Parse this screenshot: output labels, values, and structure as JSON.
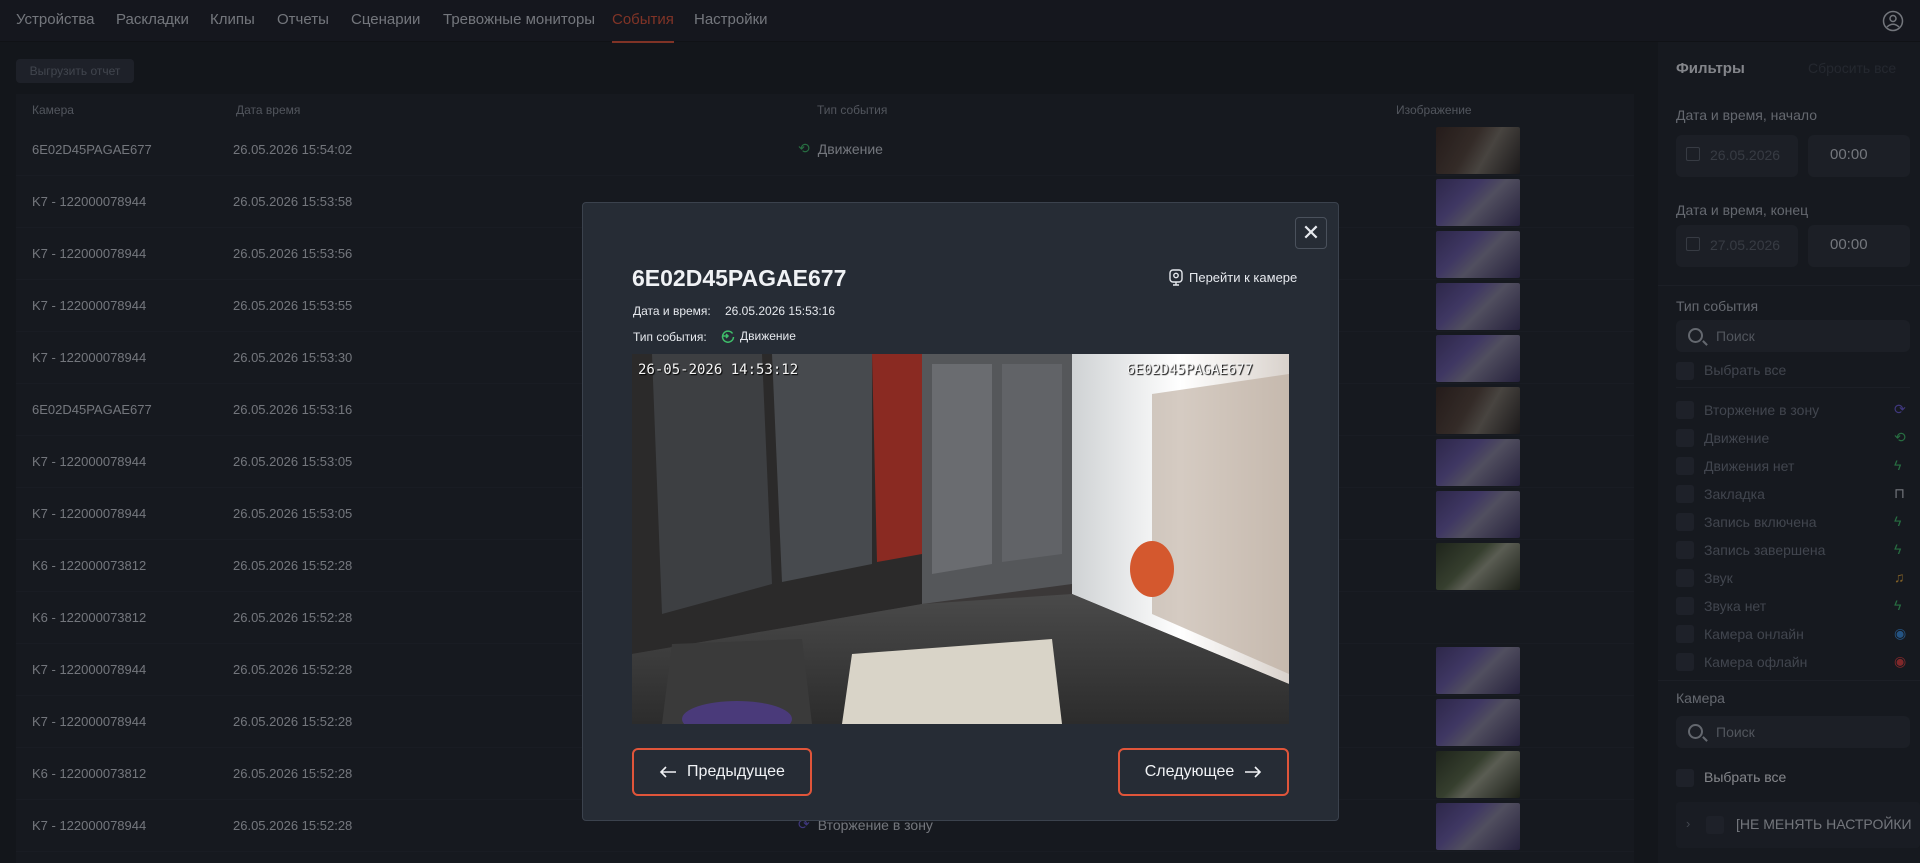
{
  "nav": {
    "tabs": [
      "Устройства",
      "Раскладки",
      "Клипы",
      "Отчеты",
      "Сценарии",
      "Тревожные мониторы",
      "События",
      "Настройки"
    ],
    "active": "События"
  },
  "toolbar": {
    "export_label": "Выгрузить отчет"
  },
  "table": {
    "headers": {
      "camera": "Камера",
      "datetime": "Дата время",
      "event_type": "Тип события",
      "image": "Изображение"
    },
    "rows": [
      {
        "camera": "6E02D45PAGAE677",
        "datetime": "26.05.2026 15:54:02",
        "event": "Движение",
        "event_icon": "motion-icon",
        "thumb": "dark"
      },
      {
        "camera": "K7 - 122000078944",
        "datetime": "26.05.2026 15:53:58",
        "event": "",
        "event_icon": "",
        "thumb": "purple"
      },
      {
        "camera": "K7 - 122000078944",
        "datetime": "26.05.2026 15:53:56",
        "event": "",
        "event_icon": "",
        "thumb": "purple"
      },
      {
        "camera": "K7 - 122000078944",
        "datetime": "26.05.2026 15:53:55",
        "event": "",
        "event_icon": "",
        "thumb": "purple"
      },
      {
        "camera": "K7 - 122000078944",
        "datetime": "26.05.2026 15:53:30",
        "event": "",
        "event_icon": "",
        "thumb": "purple"
      },
      {
        "camera": "6E02D45PAGAE677",
        "datetime": "26.05.2026 15:53:16",
        "event": "",
        "event_icon": "",
        "thumb": "dark"
      },
      {
        "camera": "K7 - 122000078944",
        "datetime": "26.05.2026 15:53:05",
        "event": "",
        "event_icon": "",
        "thumb": "purple"
      },
      {
        "camera": "K7 - 122000078944",
        "datetime": "26.05.2026 15:53:05",
        "event": "",
        "event_icon": "",
        "thumb": "purple"
      },
      {
        "camera": "K6 - 122000073812",
        "datetime": "26.05.2026 15:52:28",
        "event": "",
        "event_icon": "",
        "thumb": "green"
      },
      {
        "camera": "K6 - 122000073812",
        "datetime": "26.05.2026 15:52:28",
        "event": "",
        "event_icon": "",
        "thumb": ""
      },
      {
        "camera": "K7 - 122000078944",
        "datetime": "26.05.2026 15:52:28",
        "event": "",
        "event_icon": "",
        "thumb": "purple"
      },
      {
        "camera": "K7 - 122000078944",
        "datetime": "26.05.2026 15:52:28",
        "event": "",
        "event_icon": "",
        "thumb": "purple"
      },
      {
        "camera": "K6 - 122000073812",
        "datetime": "26.05.2026 15:52:28",
        "event": "",
        "event_icon": "",
        "thumb": "green"
      },
      {
        "camera": "K7 - 122000078944",
        "datetime": "26.05.2026 15:52:28",
        "event": "Вторжение в зону",
        "event_icon": "intrusion-icon",
        "thumb": "purple"
      }
    ]
  },
  "filters": {
    "title": "Фильтры",
    "reset_label": "Сбросить все",
    "start": {
      "label": "Дата и время, начало",
      "date": "26.05.2026",
      "time": "00:00"
    },
    "end": {
      "label": "Дата и время, конец",
      "date": "27.05.2026",
      "time": "00:00"
    },
    "event_type": {
      "label": "Тип события",
      "search_placeholder": "Поиск",
      "select_all": "Выбрать все",
      "items": [
        {
          "label": "Вторжение в зону",
          "icon": "intrusion-icon",
          "color": "#6a5cd8",
          "glyph": "⟳"
        },
        {
          "label": "Движение",
          "icon": "motion-icon",
          "color": "#3fbf6a",
          "glyph": "⟲"
        },
        {
          "label": "Движения нет",
          "icon": "lightning-icon",
          "color": "#3fbf6a",
          "glyph": "ϟ"
        },
        {
          "label": "Закладка",
          "icon": "bookmark-icon",
          "color": "#c9ced6",
          "glyph": "⊓"
        },
        {
          "label": "Запись включена",
          "icon": "lightning-icon",
          "color": "#3fbf6a",
          "glyph": "ϟ"
        },
        {
          "label": "Запись завершена",
          "icon": "lightning-icon",
          "color": "#3fbf6a",
          "glyph": "ϟ"
        },
        {
          "label": "Звук",
          "icon": "music-note-icon",
          "color": "#e0a53a",
          "glyph": "♫"
        },
        {
          "label": "Звука нет",
          "icon": "lightning-icon",
          "color": "#3fbf6a",
          "glyph": "ϟ"
        },
        {
          "label": "Камера онлайн",
          "icon": "camera-online-icon",
          "color": "#3a8fe0",
          "glyph": "◉"
        },
        {
          "label": "Камера офлайн",
          "icon": "camera-offline-icon",
          "color": "#e04040",
          "glyph": "◉"
        }
      ]
    },
    "camera": {
      "label": "Камера",
      "search_placeholder": "Поиск",
      "select_all": "Выбрать все",
      "group": "[НЕ МЕНЯТЬ НАСТРОЙКИ"
    }
  },
  "modal": {
    "title": "6E02D45PAGAE677",
    "goto_label": "Перейти к камере",
    "datetime_label": "Дата и время:",
    "datetime_value": "26.05.2026 15:53:16",
    "event_label": "Тип события:",
    "event_value": "Движение",
    "osd_timestamp": "26-05-2026 14:53:12",
    "osd_camera": "6E02D45PAGAE677",
    "prev_label": "Предыдущее",
    "next_label": "Следующее",
    "close_glyph": "✕"
  },
  "colors": {
    "accent": "#e0553a",
    "motion": "#3fbf6a",
    "intrusion": "#6a5cd8"
  }
}
